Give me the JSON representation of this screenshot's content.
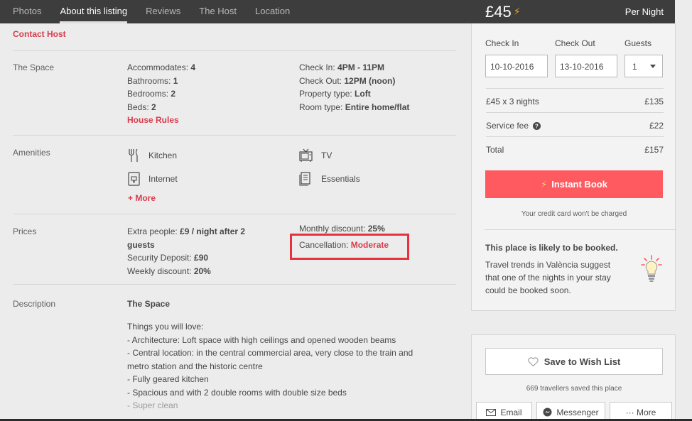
{
  "nav": {
    "tabs": [
      {
        "label": "Photos"
      },
      {
        "label": "About this listing"
      },
      {
        "label": "Reviews"
      },
      {
        "label": "The Host"
      },
      {
        "label": "Location"
      }
    ]
  },
  "price": {
    "amount": "£45",
    "bolt": "⚡",
    "per": "Per Night"
  },
  "contact": "Contact Host",
  "space": {
    "label": "The Space",
    "left": [
      {
        "k": "Accommodates: ",
        "v": "4"
      },
      {
        "k": "Bathrooms: ",
        "v": "1"
      },
      {
        "k": "Bedrooms: ",
        "v": "2"
      },
      {
        "k": "Beds: ",
        "v": "2"
      }
    ],
    "house_rules": "House Rules",
    "right": [
      {
        "k": "Check In: ",
        "v": "4PM - 11PM"
      },
      {
        "k": "Check Out: ",
        "v": "12PM (noon)"
      },
      {
        "k": "Property type: ",
        "v": "Loft"
      },
      {
        "k": "Room type: ",
        "v": "Entire home/flat"
      }
    ]
  },
  "amenities": {
    "label": "Amenities",
    "items": [
      "Kitchen",
      "TV",
      "Internet",
      "Essentials"
    ],
    "more": "+ More"
  },
  "prices": {
    "label": "Prices",
    "extra_k": "Extra people: ",
    "extra_v1": "£9 / night after 2",
    "extra_v2": "guests",
    "deposit_k": "Security Deposit: ",
    "deposit_v": "£90",
    "weekly_k": "Weekly discount: ",
    "weekly_v": "20%",
    "monthly_k": "Monthly discount: ",
    "monthly_v": "25%",
    "cancel_k": "Cancellation: ",
    "cancel_v": "Moderate"
  },
  "description": {
    "label": "Description",
    "heading": "The Space",
    "lines": [
      "Things you will love:",
      "- Architecture: Loft space with high ceilings and opened wooden beams",
      "- Central location: in the central commercial area, very close to the train and",
      "metro station and the historic centre",
      "- Fully geared kitchen",
      "- Spacious and with 2 double rooms with double size beds",
      "- Super clean"
    ]
  },
  "booking": {
    "checkin_label": "Check In",
    "checkout_label": "Check Out",
    "guests_label": "Guests",
    "checkin_value": "10-10-2016",
    "checkout_value": "13-10-2016",
    "guests_value": "1",
    "nights_label": "£45 x 3 nights",
    "nights_total": "£135",
    "service_label": "Service fee",
    "service_total": "£22",
    "total_label": "Total",
    "total_value": "£157",
    "instant_book": "Instant Book",
    "no_charge": "Your credit card won't be charged",
    "likely_title": "This place is likely to be booked.",
    "likely_lines": [
      "Travel trends in València suggest",
      "that one of the nights in your stay",
      "could be booked soon."
    ]
  },
  "wishlist": {
    "button": "Save to Wish List",
    "saved": "669 travellers saved this place",
    "email": "Email",
    "messenger": "Messenger",
    "more": "··· More"
  },
  "colors": {
    "accent": "#ff5a5f",
    "link": "#d93b4a",
    "highlight": "#e6323e",
    "dark": "#3d3d3d"
  }
}
